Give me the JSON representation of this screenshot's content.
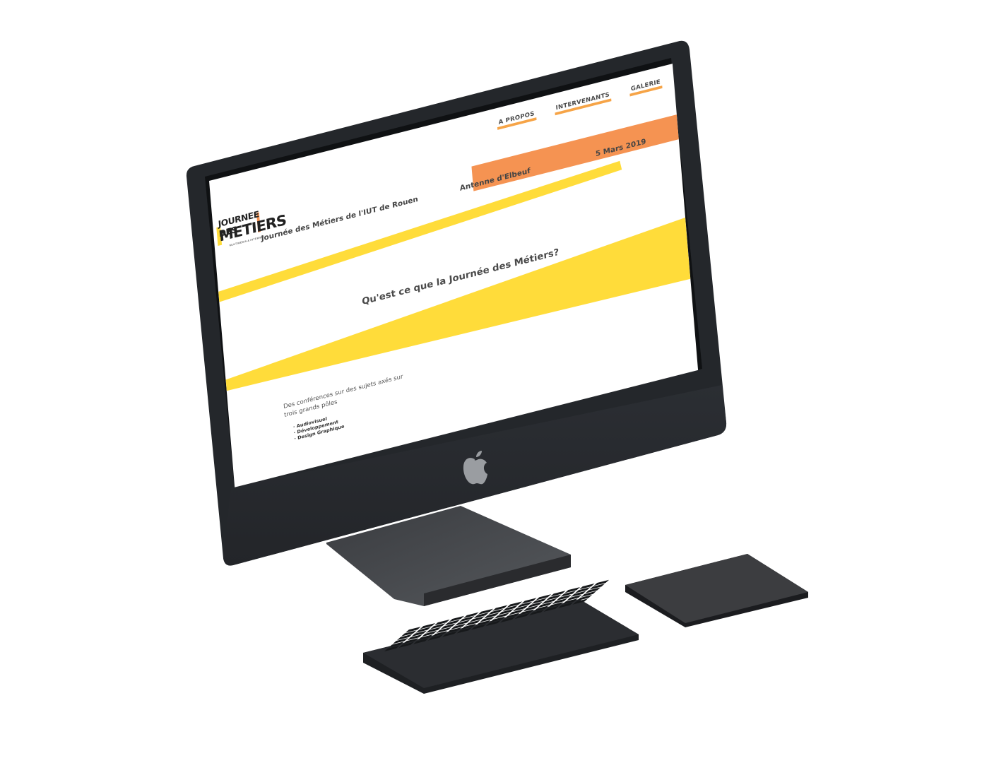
{
  "site": {
    "logo": {
      "line1": "JOURNEE DES",
      "line2": "METIERS",
      "subtitle": "MULTIMEDIA & INTERNET"
    },
    "nav": {
      "items": [
        {
          "label": "A PROPOS"
        },
        {
          "label": "INTERVENANTS"
        },
        {
          "label": "GALERIE"
        }
      ]
    },
    "info": {
      "title": "Journée des Métiers de l'IUT de Rouen",
      "place": "Antenne d'Elbeuf",
      "date": "5 Mars 2019"
    },
    "hero": {
      "title": "Qu'est ce que la Journée des Métiers?"
    },
    "intro": {
      "text": "Des conférences sur des sujets axés sur trois grands pôles",
      "poles": [
        "Audiovisuel",
        "Développement",
        "Design Graphique"
      ]
    }
  },
  "colors": {
    "accent_orange": "#f59352",
    "accent_yellow": "#ffdc3a",
    "nav_underline": "#f6a447",
    "device_body": "#2a2d32"
  },
  "icons": {
    "device_logo": "apple-logo-icon"
  }
}
